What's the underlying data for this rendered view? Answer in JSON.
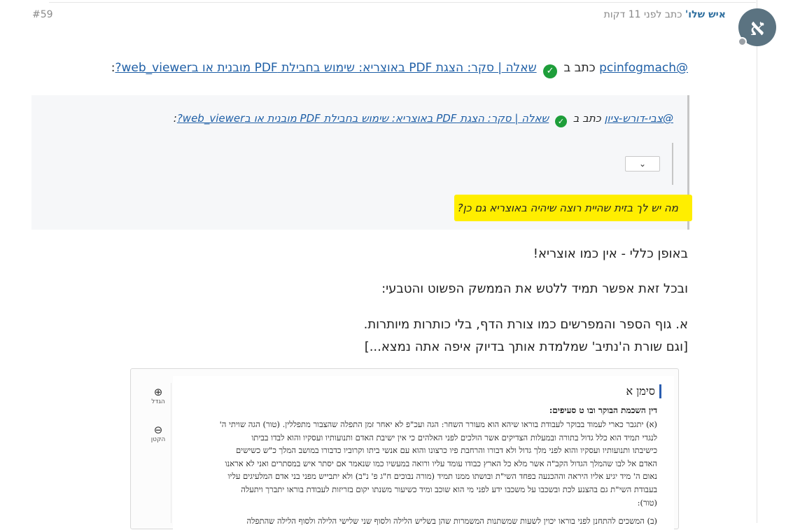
{
  "post": {
    "avatar_letter": "א",
    "author": "איש שלו'",
    "meta": "כתב לפני 11 דקות",
    "number": "#59"
  },
  "quote": {
    "mention": "@pcinfogmach",
    "wrote_in": "כתב ב",
    "topic": "שאלה | סקר: הצגת PDF באוצריא: שימוש בחבילת PDF מובנית או בweb_viewer?",
    "colon": ":"
  },
  "nested_quote": {
    "mention": "@צבי-דורש-ציון",
    "wrote_in": "כתב ב",
    "topic": "שאלה | סקר: הצגת PDF באוצריא: שימוש בחבילת PDF מובנית או בweb_viewer?",
    "colon": ":",
    "expand_icon": "chevron-down-icon",
    "expand_glyph": "⌄",
    "highlighted_text": "מה יש לך בזית שהיית רוצה שיהיה באוצריא גם כן?",
    "highlight_color": "#ffee00"
  },
  "body": {
    "p1": "באופן כללי - אין כמו אוצריא!",
    "p2": "ובכל זאת אפשר תמיד ללטש את הממשק הפשוט והטבעי:",
    "p3": "א. גוף הספר והמפרשים כמו צורת הדף, בלי כותרות מיותרות.",
    "p4": "[וגם שורת ה'נתיב' שמלמדת אותך בדיוק איפה אתה נמצא...]"
  },
  "screenshot": {
    "zoom_in_glyph": "⊕",
    "zoom_in_label": "הגדל",
    "zoom_out_glyph": "⊖",
    "zoom_out_label": "הקטן",
    "siman_title": "סימן א",
    "heading": "דין השכמת הבוקר ובו ט סעיפים:",
    "lines": [
      "(א) יתגבר כארי לעמוד בבוקר לעבודת בוראו שיהא הוא מעורר השחר: הגה ועכ\"פ לא יאחר זמן התפלה שהצבור מתפללין. (טור) הגה שויתי ה'",
      "לנגדי תמיד הוא כלל גדול בתורה ובמעלות הצדיקים אשר הולכים לפני האלהים כי אין ישיבת האדם ותנועותיו ועסקיו והוא לבדו בביתו",
      "כישיבתו ותנועותיו ועסקיו והוא לפני מלך גדול ולא דבורו והרחבת פיו כרצונו והוא עם אנשי ביתו וקרוביו כדבורו במושב המלך כ\"ש כשישים",
      "האדם אל לבו שהמלך הגדול הקב\"ה אשר מלא כל הארץ כבודו עומד עליו ורואה במעשיו כמו שנאמר אם יסתר איש במסתרים ואני לא אראנו",
      "נאום ה' מיד יגיע אליו היראה וההכנעה בפחד השי\"ת ובושתו ממנו תמיד (מורה נבוכים ח\"ג פ' נ\"ב) ולא יתבייש מפני בני אדם המלעיגים עליו",
      "בעבודת השי\"ת גם בהצנע לכת ובשכבו על משכבו ידע לפני מי הוא שוכב ומיד כשיעור משנתו יקום בזריזות לעבודת בוראו יתברך ויתעלה",
      "(טור):",
      "(ב) המשכים להתחנן לפני בוראו יכוין לשעות שמשתנות המשמרות שהן בשליש הלילה ולסוף שני שלישי הלילה ולסוף הלילה שהתפלה"
    ]
  }
}
